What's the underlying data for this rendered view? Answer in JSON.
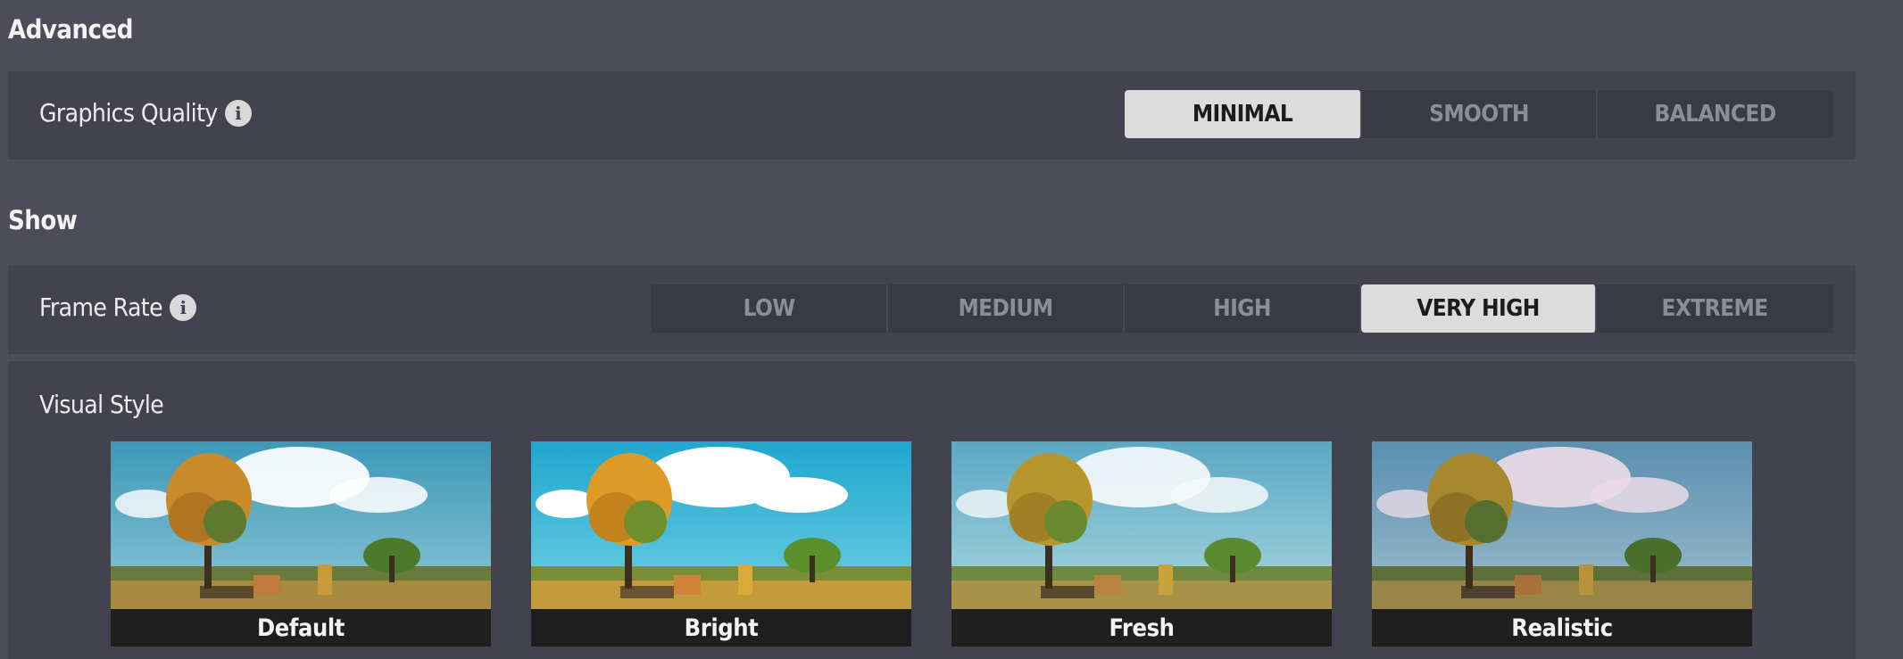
{
  "sections": {
    "advanced_title": "Advanced",
    "show_title": "Show"
  },
  "graphics_quality": {
    "label": "Graphics Quality",
    "options": [
      "MINIMAL",
      "SMOOTH",
      "BALANCED"
    ],
    "selected": "MINIMAL"
  },
  "frame_rate": {
    "label": "Frame Rate",
    "options": [
      "LOW",
      "MEDIUM",
      "HIGH",
      "VERY HIGH",
      "EXTREME"
    ],
    "selected": "VERY HIGH"
  },
  "visual_style": {
    "label": "Visual Style",
    "styles": [
      {
        "name": "Default"
      },
      {
        "name": "Bright"
      },
      {
        "name": "Fresh"
      },
      {
        "name": "Realistic"
      }
    ]
  },
  "colors": {
    "background": "#4d4d59",
    "panel": "#43434f",
    "segment_bg": "#3a3a45",
    "segment_active": "#dcdcdc",
    "caption_bg": "#1e1f1e"
  },
  "icons": {
    "info": "info-icon"
  }
}
